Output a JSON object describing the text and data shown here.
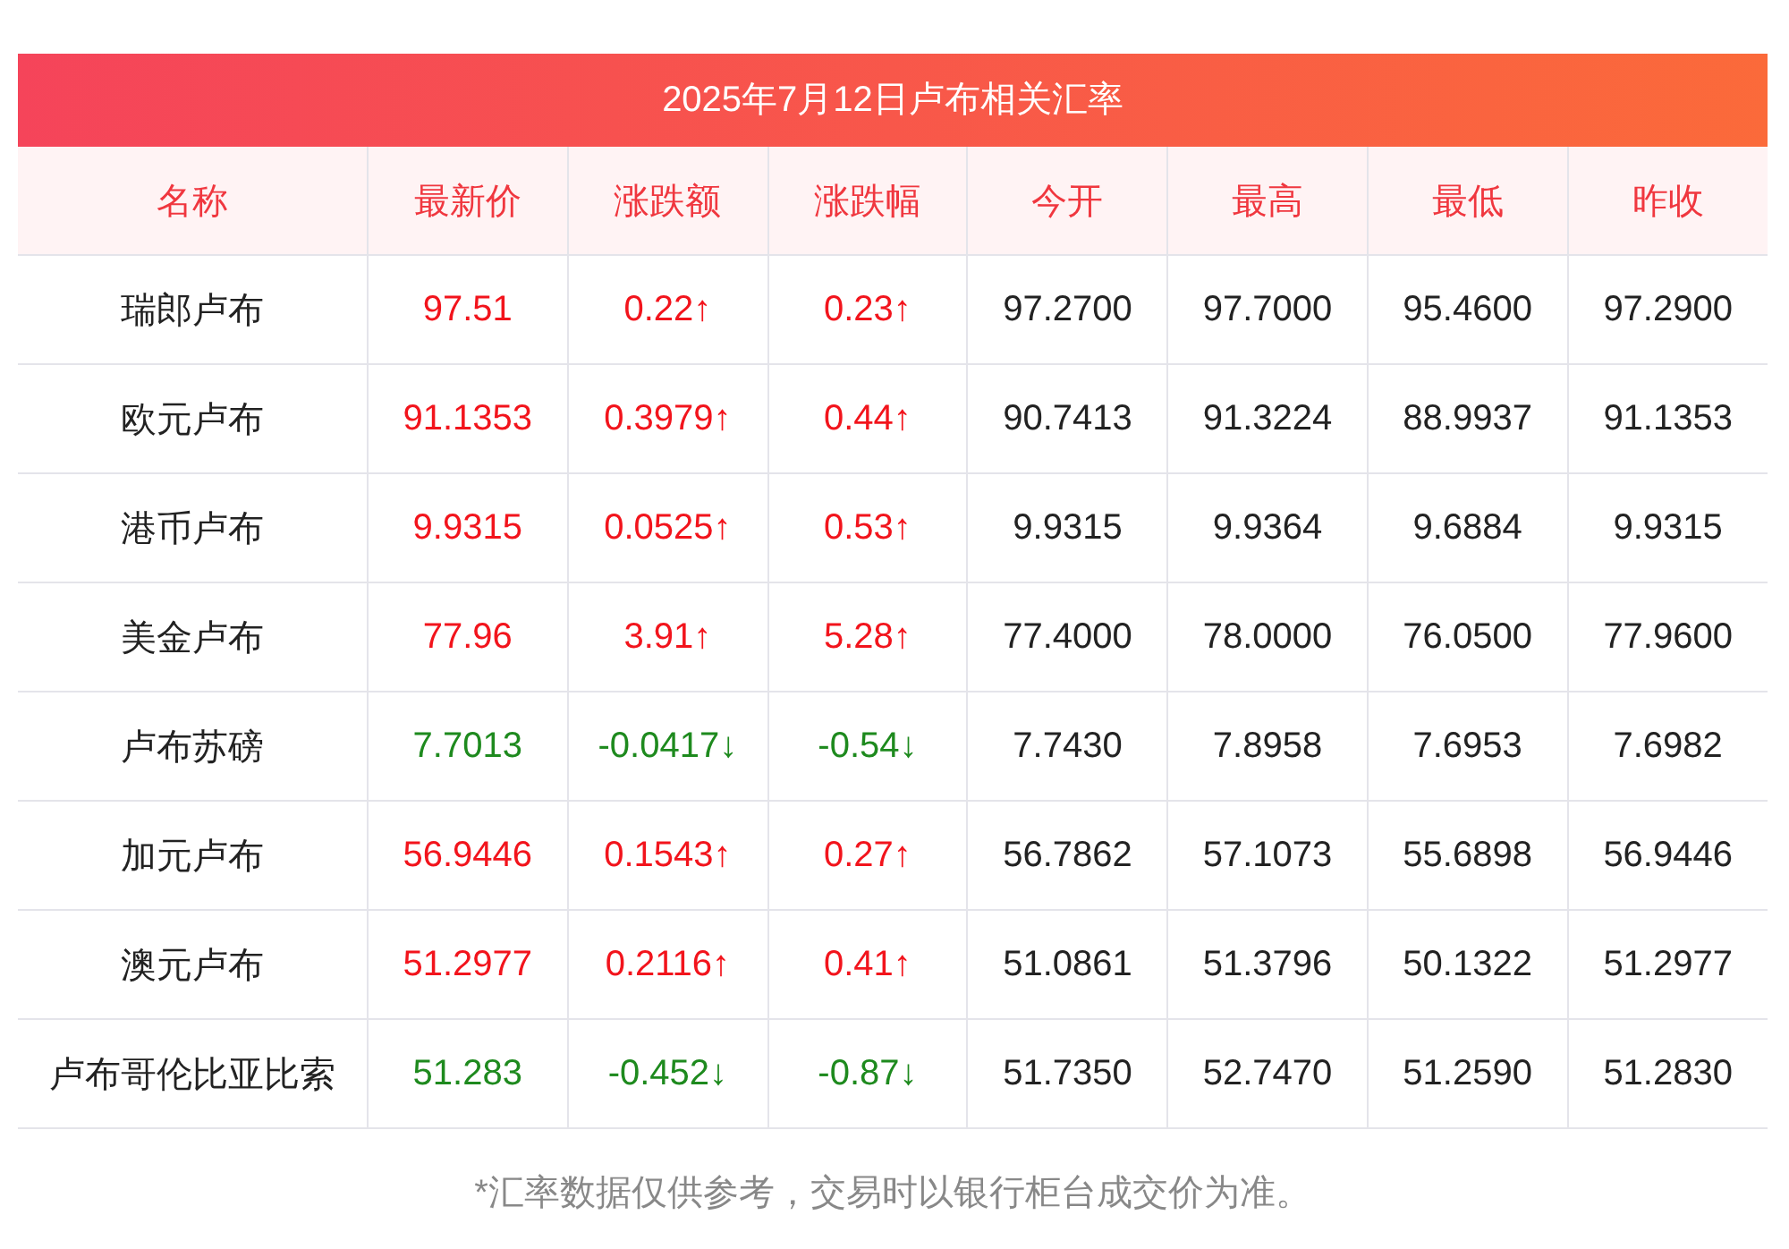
{
  "title": "2025年7月12日卢布相关汇率",
  "columns": [
    "名称",
    "最新价",
    "涨跌额",
    "涨跌幅",
    "今开",
    "最高",
    "最低",
    "昨收"
  ],
  "rows": [
    {
      "name": "瑞郎卢布",
      "color": "#f2141c",
      "cells": [
        "97.51",
        "0.22↑",
        "0.23↑",
        "97.2700",
        "97.7000",
        "95.4600",
        "97.2900"
      ]
    },
    {
      "name": "欧元卢布",
      "color": "#f2141c",
      "cells": [
        "91.1353",
        "0.3979↑",
        "0.44↑",
        "90.7413",
        "91.3224",
        "88.9937",
        "91.1353"
      ]
    },
    {
      "name": "港币卢布",
      "color": "#f2141c",
      "cells": [
        "9.9315",
        "0.0525↑",
        "0.53↑",
        "9.9315",
        "9.9364",
        "9.6884",
        "9.9315"
      ]
    },
    {
      "name": "美金卢布",
      "color": "#f2141c",
      "cells": [
        "77.96",
        "3.91↑",
        "5.28↑",
        "77.4000",
        "78.0000",
        "76.0500",
        "77.9600"
      ]
    },
    {
      "name": "卢布苏磅",
      "color": "#1e8a1e",
      "cells": [
        "7.7013",
        "-0.0417↓",
        "-0.54↓",
        "7.7430",
        "7.8958",
        "7.6953",
        "7.6982"
      ]
    },
    {
      "name": "加元卢布",
      "color": "#f2141c",
      "cells": [
        "56.9446",
        "0.1543↑",
        "0.27↑",
        "56.7862",
        "57.1073",
        "55.6898",
        "56.9446"
      ]
    },
    {
      "name": "澳元卢布",
      "color": "#f2141c",
      "cells": [
        "51.2977",
        "0.2116↑",
        "0.41↑",
        "51.0861",
        "51.3796",
        "50.1322",
        "51.2977"
      ]
    },
    {
      "name": "卢布哥伦比亚比索",
      "color": "#1e8a1e",
      "cells": [
        "51.283",
        "-0.452↓",
        "-0.87↓",
        "51.7350",
        "52.7470",
        "51.2590",
        "51.2830"
      ]
    }
  ],
  "note": "*汇率数据仅供参考，交易时以银行柜台成交价为准。"
}
